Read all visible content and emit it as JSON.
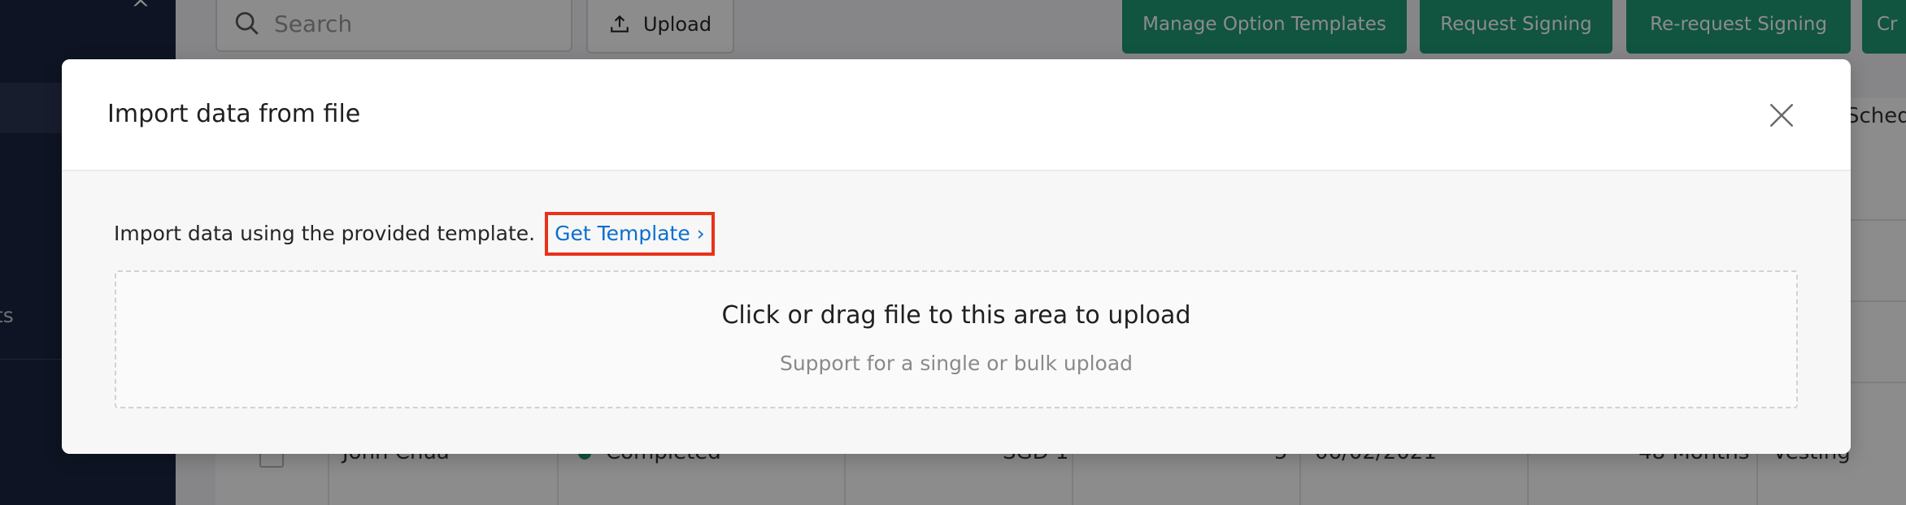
{
  "background": {
    "sidebar": {
      "collapse_glyph": "^",
      "partial_item_text": "ts"
    },
    "toolbar": {
      "search_placeholder": "Search",
      "upload_label": "Upload",
      "manage_templates_label": "Manage Option Templates",
      "request_signing_label": "Request Signing",
      "rerequest_signing_label": "Re-request Signing",
      "create_label_partial": "Cr"
    },
    "table": {
      "partial_column_header": "Schedu",
      "row": {
        "name": "John Chua",
        "status": "Completed",
        "currency": "SGD 1",
        "count": "5",
        "date": "06/02/2021",
        "duration": "48 Months",
        "type": "Vesting"
      }
    },
    "colors": {
      "sidebar": "#1b2541",
      "primary_button": "#1f9a76"
    }
  },
  "modal": {
    "title": "Import data from file",
    "close_icon": "close-icon",
    "instruction": "Import data using the provided template.",
    "template_link": "Get Template ›",
    "dropzone": {
      "title": "Click or drag file to this area to upload",
      "hint": "Support for a single or bulk upload"
    },
    "colors": {
      "link": "#0b6fcf",
      "highlight_border": "#e8331c"
    }
  }
}
